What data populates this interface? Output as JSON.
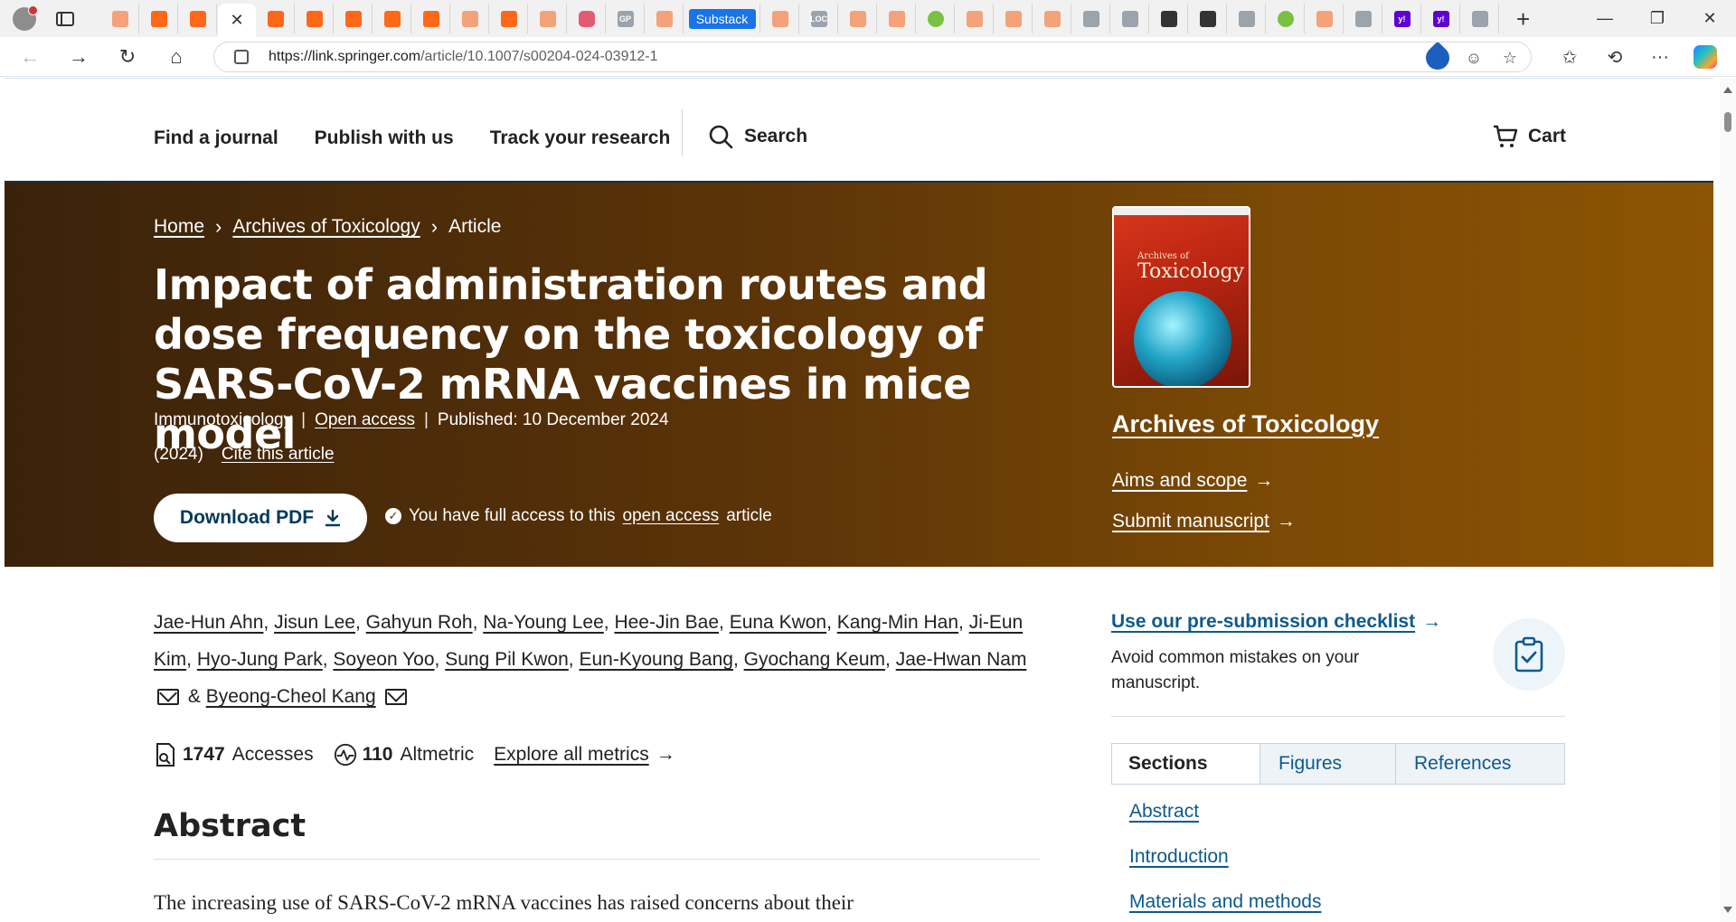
{
  "browser": {
    "active_tab_close": "✕",
    "substack_tab_label": "Substack",
    "gp_tab_label": "GP",
    "loc_tab_label": "LOC",
    "yahoo_tab_label": "y!",
    "new_tab": "+",
    "minimize": "—",
    "restore": "❐",
    "close": "✕",
    "url_host": "https://link.springer.com",
    "url_path": "/article/10.1007/s00204-024-03912-1",
    "more": "···"
  },
  "site_header": {
    "nav": [
      "Find a journal",
      "Publish with us",
      "Track your research"
    ],
    "search_label": "Search",
    "cart_label": "Cart"
  },
  "hero": {
    "breadcrumb": [
      "Home",
      "Archives of Toxicology",
      "Article"
    ],
    "title": "Impact of administration routes and dose frequency on the toxicology of SARS-CoV-2 mRNA vaccines in mice model",
    "category": "Immunotoxicology",
    "open_access": "Open access",
    "published": "Published: 10 December 2024",
    "year": "(2024)",
    "cite": "Cite this article",
    "download_pdf": "Download PDF",
    "access_prefix": "You have full access to this",
    "access_link": "open access",
    "access_suffix": "article",
    "cover_top": "Archives of",
    "cover_name": "Toxicology",
    "journal_name": "Archives of Toxicology",
    "aims": "Aims and scope",
    "submit": "Submit manuscript"
  },
  "authors": [
    "Jae-Hun Ahn",
    "Jisun Lee",
    "Gahyun Roh",
    "Na-Young Lee",
    "Hee-Jin Bae",
    "Euna Kwon",
    "Kang-Min Han",
    "Ji-Eun Kim",
    "Hyo-Jung Park",
    "Soyeon Yoo",
    "Sung Pil Kwon",
    "Eun-Kyoung Bang",
    "Gyochang Keum",
    "Jae-Hwan Nam",
    "Byeong-Cheol Kang"
  ],
  "authors_amp": "&",
  "metrics": {
    "accesses_num": "1747",
    "accesses_label": "Accesses",
    "altmetric_num": "110",
    "altmetric_label": "Altmetric",
    "explore": "Explore all metrics"
  },
  "abstract": {
    "heading": "Abstract",
    "text": "The increasing use of SARS-CoV-2 mRNA vaccines has raised concerns about their"
  },
  "sidebar": {
    "checklist_link": "Use our pre-submission checklist",
    "checklist_desc": "Avoid common mistakes on your manuscript.",
    "tabs": [
      "Sections",
      "Figures",
      "References"
    ],
    "sections": [
      "Abstract",
      "Introduction",
      "Materials and methods"
    ]
  },
  "colors": {
    "hero_start": "#3a220a",
    "hero_end": "#8c5404",
    "link_blue": "#0c5a8f",
    "pdf_text": "#003a5c"
  }
}
